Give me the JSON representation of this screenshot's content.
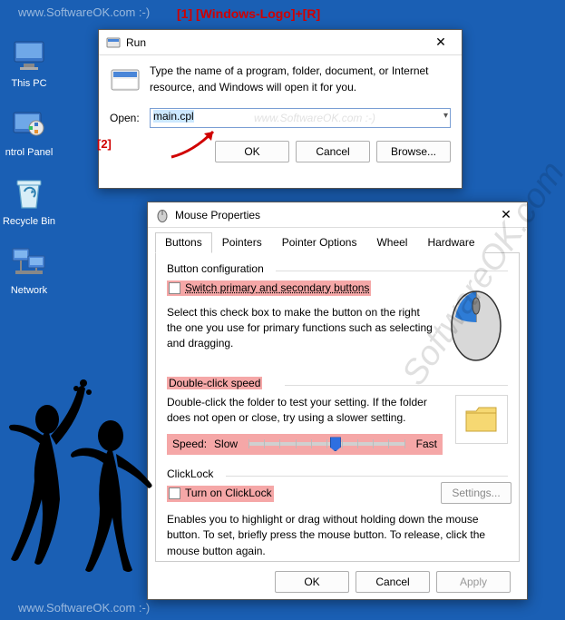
{
  "watermark": "www.SoftwareOK.com :-)",
  "watermark_diag": "SoftwareOK.com",
  "desktop": {
    "this_pc": "This PC",
    "control_panel": "ntrol Panel",
    "recycle_bin": "Recycle Bin",
    "network": "Network"
  },
  "run": {
    "title": "Run",
    "annot1": "[1]  [Windows-Logo]+[R]",
    "annot2": "[2]",
    "desc": "Type the name of a program, folder, document, or Internet resource, and Windows will open it for you.",
    "open_label": "Open:",
    "value": "main.cpl",
    "ok": "OK",
    "cancel": "Cancel",
    "browse": "Browse..."
  },
  "mouse": {
    "title": "Mouse Properties",
    "tabs": {
      "buttons": "Buttons",
      "pointers": "Pointers",
      "pointer_options": "Pointer Options",
      "wheel": "Wheel",
      "hardware": "Hardware"
    },
    "group1": {
      "title": "Button configuration",
      "cb_label": "Switch primary and secondary buttons",
      "desc": "Select this check box to make the button on the right the one you use for primary functions such as selecting and dragging."
    },
    "group2": {
      "title": "Double-click speed",
      "desc": "Double-click the folder to test your setting. If the folder does not open or close, try using a slower setting.",
      "speed_label": "Speed:",
      "slow": "Slow",
      "fast": "Fast"
    },
    "group3": {
      "title": "ClickLock",
      "cb_label": "Turn on ClickLock",
      "settings": "Settings...",
      "desc": "Enables you to highlight or drag without holding down the mouse button. To set, briefly press the mouse button. To release, click the mouse button again."
    },
    "ok": "OK",
    "cancel": "Cancel",
    "apply": "Apply"
  }
}
